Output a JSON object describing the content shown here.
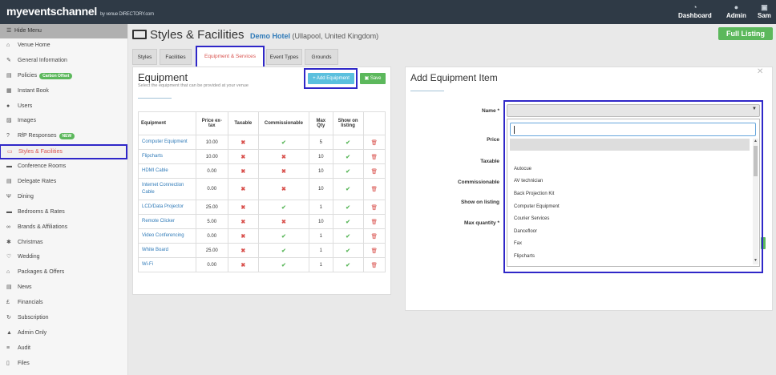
{
  "brand": {
    "name": "myeventschannel",
    "by": "by venue DIRECTORY.com"
  },
  "topnav": [
    {
      "label": "Dashboard",
      "icon": "dashboard-icon"
    },
    {
      "label": "Admin",
      "icon": "admin-icon"
    },
    {
      "label": "Sam",
      "icon": "user-icon"
    }
  ],
  "sidebar": {
    "hide_menu": "Hide Menu",
    "items": [
      {
        "label": "Venue Home",
        "icon": "home-icon"
      },
      {
        "label": "General Information",
        "icon": "pencil-icon"
      },
      {
        "label": "Policies",
        "icon": "document-icon",
        "badge": "Carbon Offset"
      },
      {
        "label": "Instant Book",
        "icon": "calendar-icon"
      },
      {
        "label": "Users",
        "icon": "user-icon"
      },
      {
        "label": "Images",
        "icon": "image-icon"
      },
      {
        "label": "RfP Responses",
        "icon": "question-icon",
        "badge": "NEW"
      },
      {
        "label": "Styles & Facilities",
        "icon": "monitor-icon"
      },
      {
        "label": "Conference Rooms",
        "icon": "room-icon"
      },
      {
        "label": "Delegate Rates",
        "icon": "rates-icon"
      },
      {
        "label": "Dining",
        "icon": "dining-icon"
      },
      {
        "label": "Bedrooms & Rates",
        "icon": "bed-icon"
      },
      {
        "label": "Brands & Affiliations",
        "icon": "link-icon"
      },
      {
        "label": "Christmas",
        "icon": "star-icon"
      },
      {
        "label": "Wedding",
        "icon": "heart-icon"
      },
      {
        "label": "Packages & Offers",
        "icon": "tag-icon"
      },
      {
        "label": "News",
        "icon": "news-icon"
      },
      {
        "label": "Financials",
        "icon": "pound-icon"
      },
      {
        "label": "Subscription",
        "icon": "refresh-icon"
      },
      {
        "label": "Admin Only",
        "icon": "warning-icon"
      },
      {
        "label": "Audit",
        "icon": "list-icon"
      },
      {
        "label": "Files",
        "icon": "file-icon"
      }
    ]
  },
  "header": {
    "title": "Styles & Facilities",
    "hotel": "Demo Hotel",
    "location": "(Ullapool, United Kingdom)",
    "listing": "Full Listing"
  },
  "tabs": [
    "Styles",
    "Facilities",
    "Equipment & Services",
    "Event Types",
    "Grounds"
  ],
  "equipment": {
    "title": "Equipment",
    "subtitle": "Select the equipment that can be provided at your venue",
    "add_button": "+ Add Equipment",
    "save_button": "Save",
    "columns": [
      "Equipment",
      "Price ex-tax",
      "Taxable",
      "Commissionable",
      "Max Qty",
      "Show on listing",
      ""
    ],
    "rows": [
      {
        "name": "Computer Equipment",
        "price": "10.00",
        "taxable": false,
        "commissionable": true,
        "max_qty": "5",
        "show": true
      },
      {
        "name": "Flipcharts",
        "price": "10.00",
        "taxable": false,
        "commissionable": false,
        "max_qty": "10",
        "show": true
      },
      {
        "name": "HDMI Cable",
        "price": "0.00",
        "taxable": false,
        "commissionable": false,
        "max_qty": "10",
        "show": true
      },
      {
        "name": "Internet Connection Cable",
        "price": "0.00",
        "taxable": false,
        "commissionable": false,
        "max_qty": "10",
        "show": true
      },
      {
        "name": "LCD/Data Projector",
        "price": "25.00",
        "taxable": false,
        "commissionable": true,
        "max_qty": "1",
        "show": true
      },
      {
        "name": "Remote Clicker",
        "price": "5.00",
        "taxable": false,
        "commissionable": false,
        "max_qty": "10",
        "show": true
      },
      {
        "name": "Video Conferencing",
        "price": "0.00",
        "taxable": false,
        "commissionable": true,
        "max_qty": "1",
        "show": true
      },
      {
        "name": "White Board",
        "price": "25.00",
        "taxable": false,
        "commissionable": true,
        "max_qty": "1",
        "show": true
      },
      {
        "name": "Wi-Fi",
        "price": "0.00",
        "taxable": false,
        "commissionable": true,
        "max_qty": "1",
        "show": true
      }
    ]
  },
  "add_item": {
    "title": "Add Equipment Item",
    "labels": [
      "Name *",
      "Price",
      "Taxable",
      "Commissionable",
      "Show on listing",
      "Max quantity *"
    ],
    "options": [
      "Autocue",
      "AV technician",
      "Back Projection Kit",
      "Computer Equipment",
      "Courier Services",
      "Dancefloor",
      "Fax",
      "Flipcharts"
    ]
  },
  "colors": {
    "accent": "#d9534f",
    "green": "#5cb85c",
    "info": "#5bc0de",
    "highlight": "#2f27c8",
    "topbar": "#2f3a46"
  }
}
